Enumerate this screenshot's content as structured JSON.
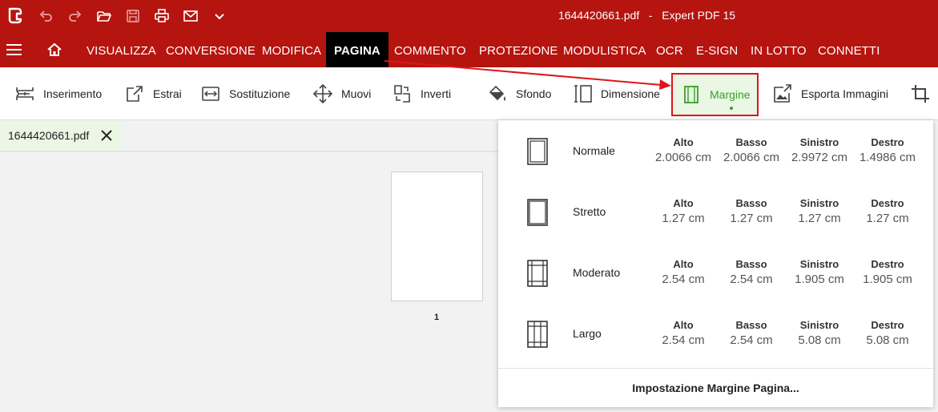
{
  "window": {
    "filename": "1644420661.pdf",
    "separator": "-",
    "app": "Expert PDF 15"
  },
  "menu": [
    "VISUALIZZA",
    "CONVERSIONE",
    "MODIFICA",
    "PAGINA",
    "COMMENTO",
    "PROTEZIONE",
    "MODULISTICA",
    "OCR",
    "E-SIGN",
    "IN LOTTO",
    "CONNETTI"
  ],
  "active_menu": "PAGINA",
  "ribbon": {
    "inserimento": "Inserimento",
    "estrai": "Estrai",
    "sostituzione": "Sostituzione",
    "muovi": "Muovi",
    "inverti": "Inverti",
    "sfondo": "Sfondo",
    "dimensione": "Dimensione",
    "margine": "Margine",
    "esporta": "Esporta Immagini"
  },
  "doc_tab": {
    "label": "1644420661.pdf"
  },
  "page": {
    "number": "1"
  },
  "margin_menu": {
    "options": [
      {
        "name": "Normale",
        "top_label": "Alto",
        "top": "2.0066 cm",
        "bottom_label": "Basso",
        "bottom": "2.0066 cm",
        "left_label": "Sinistro",
        "left": "2.9972 cm",
        "right_label": "Destro",
        "right": "1.4986 cm"
      },
      {
        "name": "Stretto",
        "top_label": "Alto",
        "top": "1.27 cm",
        "bottom_label": "Basso",
        "bottom": "1.27 cm",
        "left_label": "Sinistro",
        "left": "1.27 cm",
        "right_label": "Destro",
        "right": "1.27 cm"
      },
      {
        "name": "Moderato",
        "top_label": "Alto",
        "top": "2.54 cm",
        "bottom_label": "Basso",
        "bottom": "2.54 cm",
        "left_label": "Sinistro",
        "left": "1.905 cm",
        "right_label": "Destro",
        "right": "1.905 cm"
      },
      {
        "name": "Largo",
        "top_label": "Alto",
        "top": "2.54 cm",
        "bottom_label": "Basso",
        "bottom": "2.54 cm",
        "left_label": "Sinistro",
        "left": "5.08 cm",
        "right_label": "Destro",
        "right": "5.08 cm"
      }
    ],
    "setup_label": "Impostazione Margine Pagina..."
  },
  "colors": {
    "brand": "#b5140f",
    "active_green": "#3a9e2a",
    "highlight_red": "#e0141a"
  },
  "icons": [
    "app-logo-icon",
    "undo-icon",
    "redo-icon",
    "open-folder-icon",
    "save-icon",
    "print-icon",
    "email-icon",
    "chevron-down-icon",
    "hamburger-icon",
    "home-icon",
    "close-icon",
    "crop-icon"
  ]
}
